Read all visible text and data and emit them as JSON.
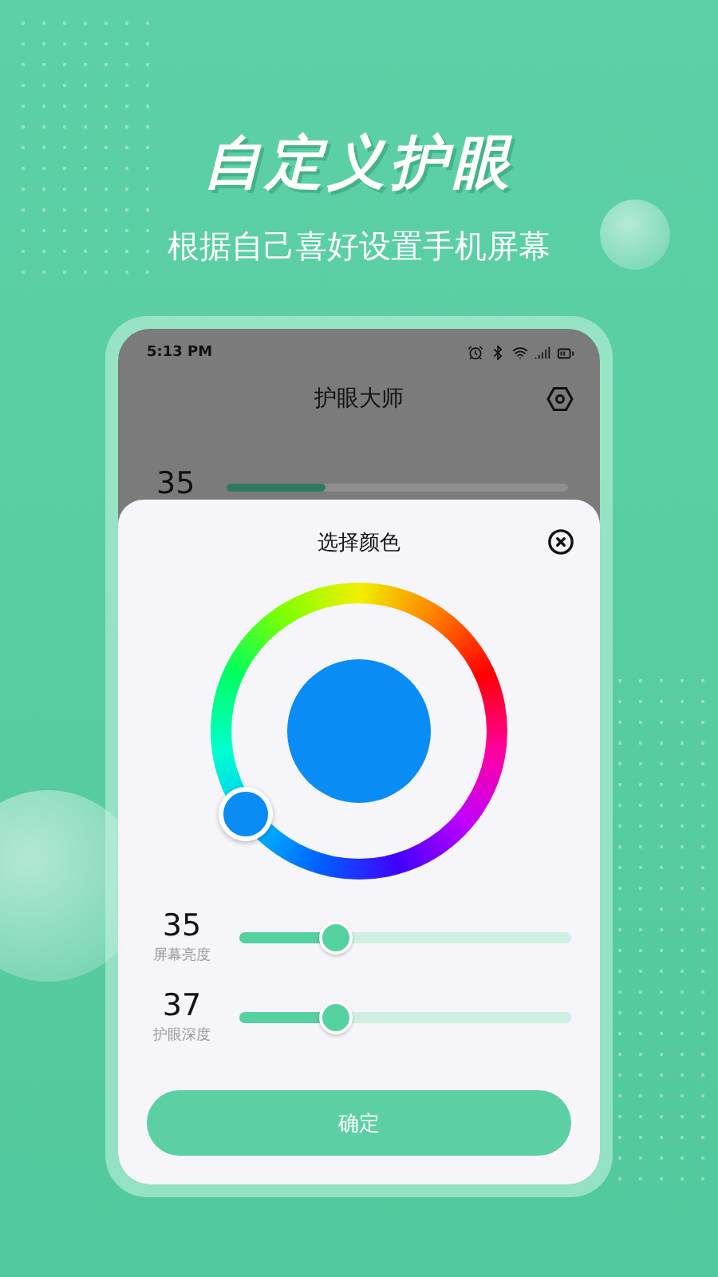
{
  "promo": {
    "title": "自定义护眼",
    "subtitle": "根据自己喜好设置手机屏幕"
  },
  "status_bar": {
    "time": "5:13 PM"
  },
  "app": {
    "title": "护眼大师",
    "background_slider": {
      "value": "35",
      "level": 0.29
    }
  },
  "dialog": {
    "title": "选择颜色",
    "color": "#0a8cf5",
    "sliders": [
      {
        "value": "35",
        "label": "屏幕亮度",
        "level": 0.29
      },
      {
        "value": "37",
        "label": "护眼深度",
        "level": 0.29
      }
    ],
    "confirm": "确定"
  }
}
